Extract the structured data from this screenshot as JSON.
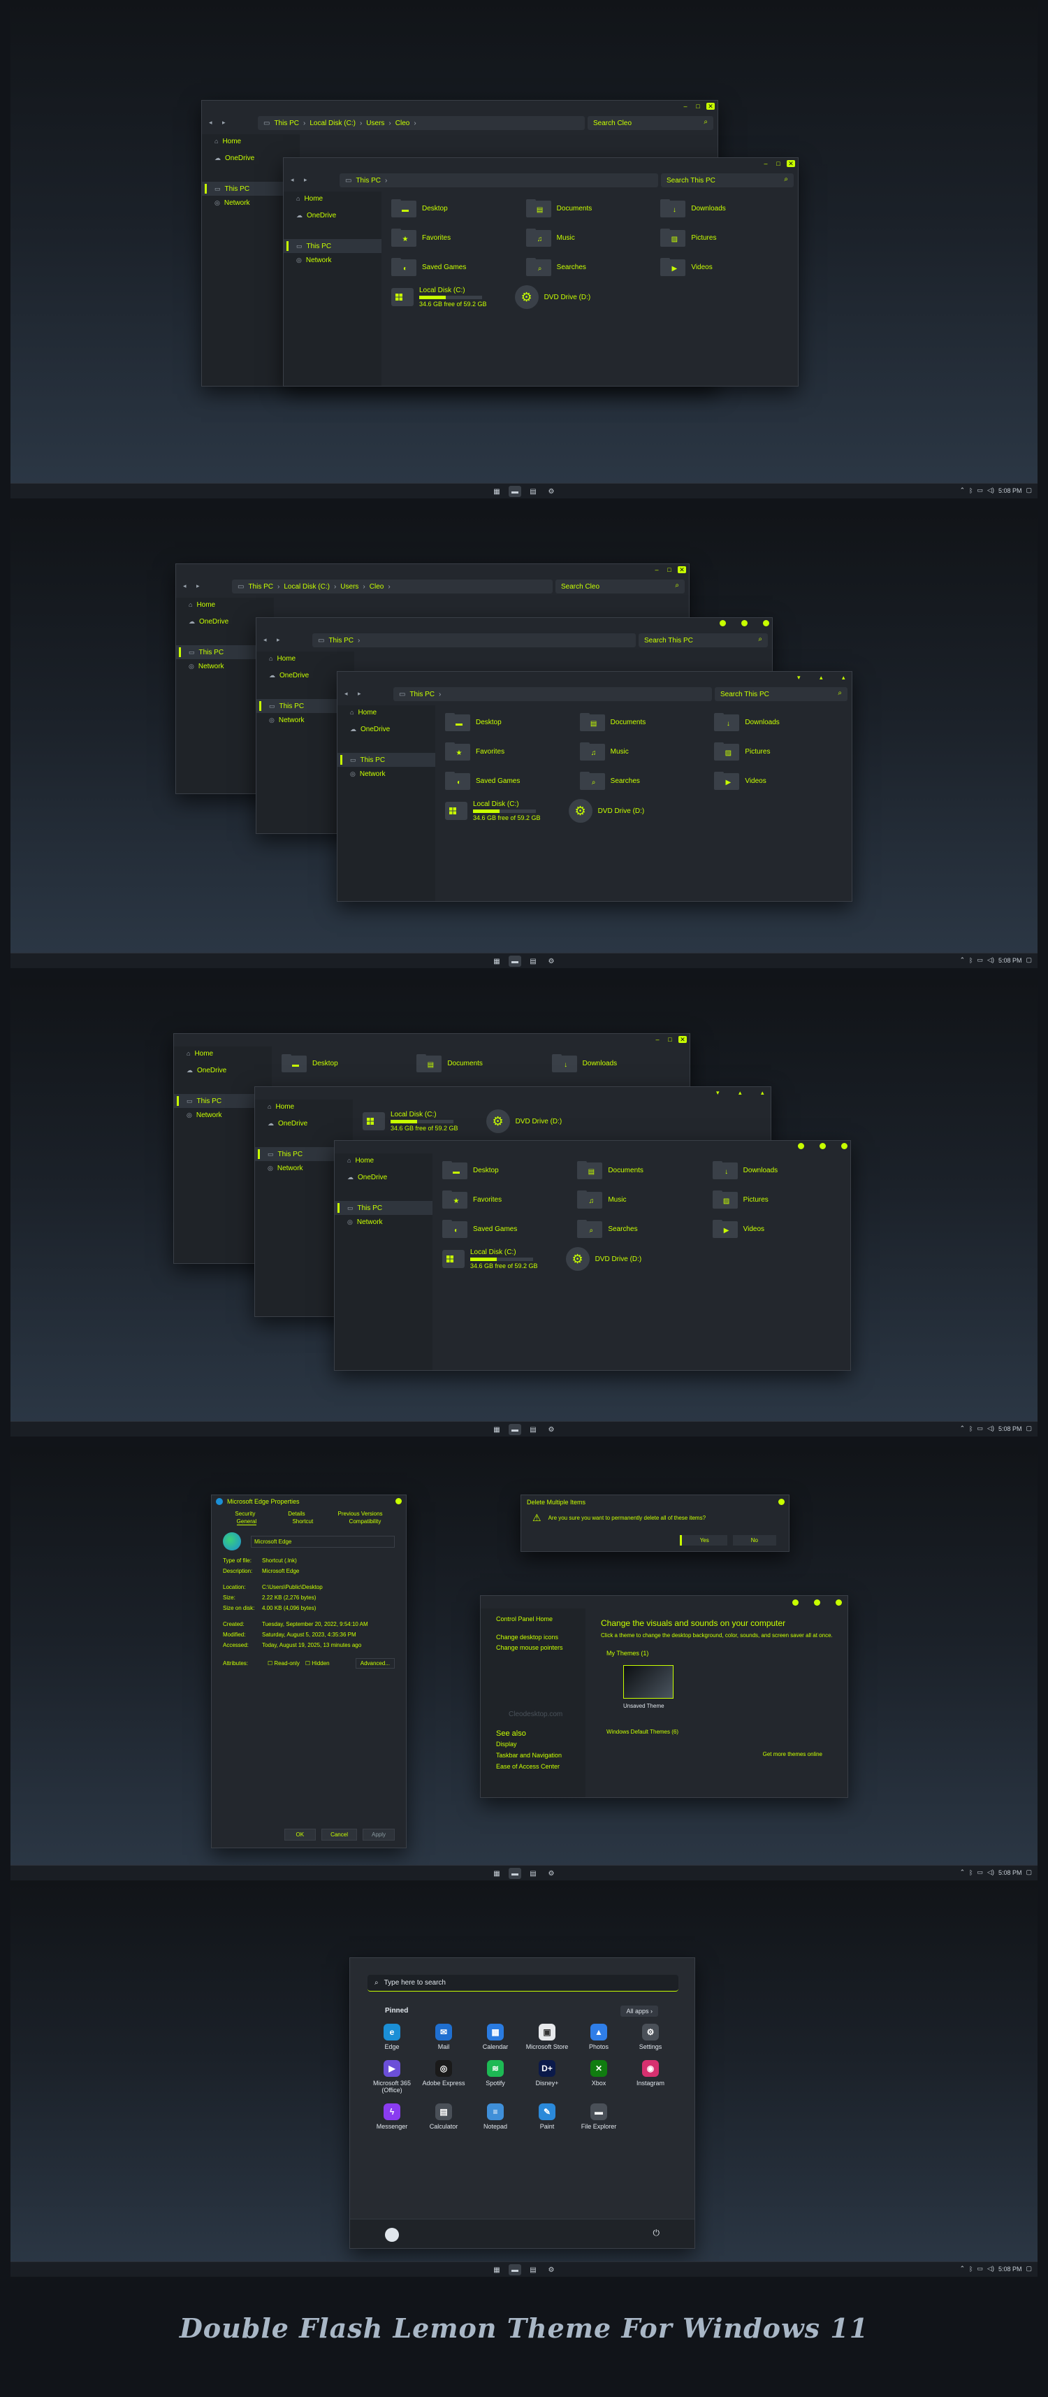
{
  "colors": {
    "accent": "#c8ff00",
    "window": "#23272d",
    "sidebar": "#1f2328"
  },
  "explorer": {
    "breadcrumb_long": [
      "This PC",
      "Local Disk (C:)",
      "Users",
      "Cleo"
    ],
    "breadcrumb_short": [
      "This PC"
    ],
    "search_cleo": "Search Cleo",
    "search_pc": "Search This PC",
    "nav": [
      "Home",
      "OneDrive",
      "This PC",
      "Network"
    ],
    "folders": [
      "Desktop",
      "Documents",
      "Downloads",
      "Favorites",
      "Music",
      "Pictures",
      "Saved Games",
      "Searches",
      "Videos"
    ],
    "drive": {
      "name": "Local Disk (C:)",
      "free": "34.6 GB free of 59.2 GB",
      "used_fraction": 0.42
    },
    "dvd": "DVD Drive (D:)"
  },
  "taskbar": {
    "time": "5:08 PM"
  },
  "props": {
    "title": "Microsoft Edge Properties",
    "tabs_row1": [
      "Security",
      "Details",
      "Previous Versions"
    ],
    "tabs_row2": [
      "General",
      "Shortcut",
      "Compatibility"
    ],
    "name": "Microsoft Edge",
    "rows": [
      {
        "k": "Type of file:",
        "v": "Shortcut (.lnk)"
      },
      {
        "k": "Description:",
        "v": "Microsoft Edge"
      },
      {
        "k": "Location:",
        "v": "C:\\Users\\Public\\Desktop"
      },
      {
        "k": "Size:",
        "v": "2.22 KB (2,276 bytes)"
      },
      {
        "k": "Size on disk:",
        "v": "4.00 KB (4,096 bytes)"
      },
      {
        "k": "Created:",
        "v": "Tuesday, September 20, 2022, 9:54:10 AM"
      },
      {
        "k": "Modified:",
        "v": "Saturday, August 5, 2023, 4:35:36 PM"
      },
      {
        "k": "Accessed:",
        "v": "Today, August 19, 2025, 13 minutes ago"
      }
    ],
    "attributes_label": "Attributes:",
    "readonly": "Read-only",
    "hidden": "Hidden",
    "advanced": "Advanced...",
    "ok": "OK",
    "cancel": "Cancel",
    "apply": "Apply"
  },
  "delete_dialog": {
    "title": "Delete Multiple Items",
    "message": "Are you sure you want to permanently delete all of these items?",
    "yes": "Yes",
    "no": "No"
  },
  "personalize": {
    "home": "Control Panel Home",
    "links": [
      "Change desktop icons",
      "Change mouse pointers"
    ],
    "heading": "Change the visuals and sounds on your computer",
    "desc": "Click a theme to change the desktop background, color, sounds, and screen saver all at once.",
    "my_themes": "My Themes (1)",
    "theme_name": "Unsaved Theme",
    "get_more": "Get more themes online",
    "watermark": "Cleodesktop.com",
    "see_also": "See also",
    "see_also_links": [
      "Display",
      "Taskbar and Navigation",
      "Ease of Access Center"
    ],
    "default_themes": "Windows Default Themes (6)"
  },
  "start": {
    "search_placeholder": "Type here to search",
    "pinned": "Pinned",
    "all_apps": "All apps",
    "apps": [
      {
        "label": "Edge",
        "icon": "edge-icon",
        "color": "#1b8fd6",
        "glyph": "e"
      },
      {
        "label": "Mail",
        "icon": "mail-icon",
        "color": "#1f6fd0",
        "glyph": "✉"
      },
      {
        "label": "Calendar",
        "icon": "calendar-icon",
        "color": "#2a7be0",
        "glyph": "▦"
      },
      {
        "label": "Microsoft Store",
        "icon": "store-icon",
        "color": "#e7e9ec",
        "glyph": "▣"
      },
      {
        "label": "Photos",
        "icon": "photos-icon",
        "color": "#2f7ee8",
        "glyph": "▲"
      },
      {
        "label": "Settings",
        "icon": "settings-icon",
        "color": "#4a5058",
        "glyph": "⚙"
      },
      {
        "label": "Microsoft 365 (Office)",
        "icon": "office-icon",
        "color": "#6b4fd8",
        "glyph": "▶"
      },
      {
        "label": "Adobe Express",
        "icon": "adobe-express-icon",
        "color": "#1a1a1a",
        "glyph": "◎"
      },
      {
        "label": "Spotify",
        "icon": "spotify-icon",
        "color": "#1db954",
        "glyph": "≋"
      },
      {
        "label": "Disney+",
        "icon": "disney-icon",
        "color": "#0b1a4a",
        "glyph": "D+"
      },
      {
        "label": "Xbox",
        "icon": "xbox-icon",
        "color": "#107c10",
        "glyph": "✕"
      },
      {
        "label": "Instagram",
        "icon": "instagram-icon",
        "color": "#d6306f",
        "glyph": "◉"
      },
      {
        "label": "Messenger",
        "icon": "messenger-icon",
        "color": "#8a3cf0",
        "glyph": "ϟ"
      },
      {
        "label": "Calculator",
        "icon": "calculator-icon",
        "color": "#4a5058",
        "glyph": "▤"
      },
      {
        "label": "Notepad",
        "icon": "notepad-icon",
        "color": "#3f8fd8",
        "glyph": "≡"
      },
      {
        "label": "Paint",
        "icon": "paint-icon",
        "color": "#2b89d9",
        "glyph": "✎"
      },
      {
        "label": "File Explorer",
        "icon": "folder-icon",
        "color": "#4a5058",
        "glyph": "▬"
      }
    ]
  },
  "footer_title": "Double Flash Lemon Theme For Windows 11"
}
